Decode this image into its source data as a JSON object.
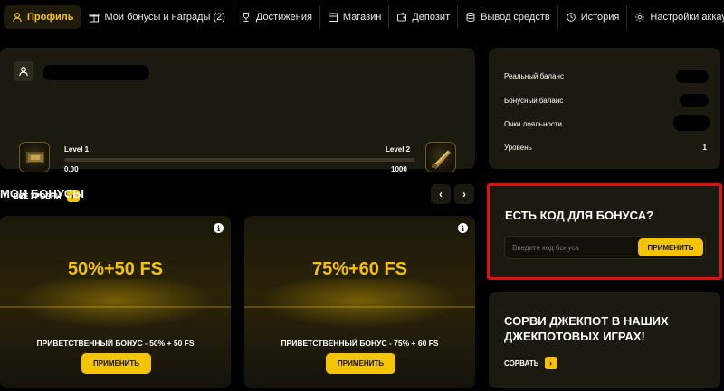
{
  "nav": {
    "items": [
      {
        "label": "Профиль",
        "icon": "user-icon"
      },
      {
        "label": "Мои бонусы и награды (2)",
        "icon": "gift-icon"
      },
      {
        "label": "Достижения",
        "icon": "trophy-icon"
      },
      {
        "label": "Магазин",
        "icon": "shop-icon"
      },
      {
        "label": "Депозит",
        "icon": "wallet-icon"
      },
      {
        "label": "Вывод средств",
        "icon": "coins-icon"
      },
      {
        "label": "История",
        "icon": "history-icon"
      },
      {
        "label": "Настройки аккаунта",
        "icon": "gear-icon"
      }
    ],
    "active_index": 0
  },
  "profile": {
    "level_current_label": "Level 1",
    "level_next_label": "Level 2",
    "points_current": "0,00",
    "points_next": "1000",
    "progress_fraction": 0,
    "all_levels_label": "ВСЕ УРОВНИ"
  },
  "balances": {
    "real_label": "Реальный баланс",
    "bonus_label": "Бонусный баланс",
    "loyalty_label": "Очки лояльности",
    "level_label": "Уровень",
    "level_value": "1"
  },
  "bonuses": {
    "section_title": "МОИ БОНУСЫ",
    "items": [
      {
        "title": "50%+50 FS",
        "description": "ПРИВЕТСТВЕННЫЙ БОНУС - 50% + 50 FS",
        "apply_label": "ПРИМЕНИТЬ"
      },
      {
        "title": "75%+60 FS",
        "description": "ПРИВЕТСТВЕННЫЙ БОНУС - 75% + 60 FS",
        "apply_label": "ПРИМЕНИТЬ"
      }
    ]
  },
  "promo": {
    "title": "ЕСТЬ КОД ДЛЯ БОНУСА?",
    "placeholder": "Введите код бонуса",
    "apply_label": "ПРИМЕНИТЬ"
  },
  "jackpot": {
    "title": "СОРВИ ДЖЕКПОТ В НАШИХ ДЖЕКПОТОВЫХ ИГРАХ!",
    "link_label": "СОРВАТЬ"
  },
  "colors": {
    "accent": "#f5c400",
    "card_bg": "#1b1a10",
    "highlight_border": "#e60d0d"
  }
}
